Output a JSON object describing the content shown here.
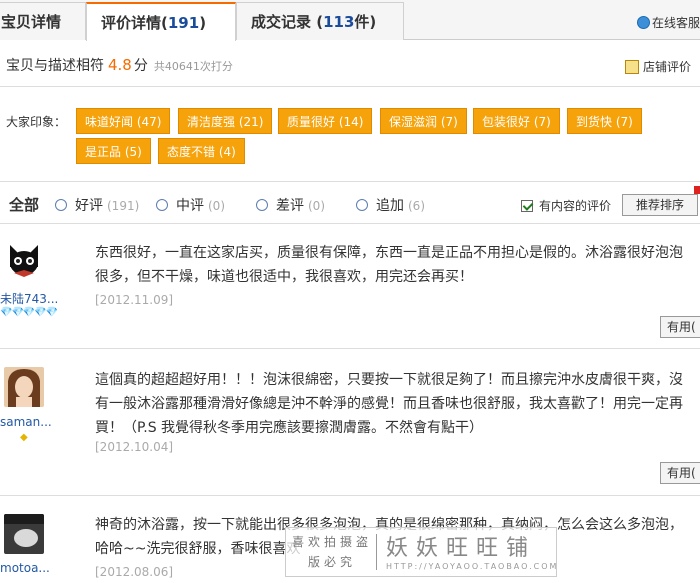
{
  "tabs": [
    {
      "label": "宝贝详情",
      "count": ""
    },
    {
      "label": "评价详情",
      "count": "191"
    },
    {
      "label": "成交记录",
      "count": "113",
      "suffix": "件"
    }
  ],
  "online_service": "在线客服",
  "score": {
    "label": "宝贝与描述相符",
    "value": "4.8",
    "unit": "分",
    "count_text": "共40641次打分",
    "shop_rating": "店铺评价"
  },
  "impressions": {
    "label": "大家印象：",
    "tags": [
      "味道好闻 (47)",
      "清洁度强 (21)",
      "质量很好 (14)",
      "保湿滋润 (7)",
      "包装很好 (7)",
      "到货快 (7)",
      "是正品 (5)",
      "态度不错 (4)"
    ]
  },
  "filter": {
    "all": "全部",
    "options": [
      {
        "label": "好评",
        "count": "(191)"
      },
      {
        "label": "中评",
        "count": "(0)"
      },
      {
        "label": "差评",
        "count": "(0)"
      },
      {
        "label": "追加",
        "count": "(6)"
      }
    ],
    "with_content": "有内容的评价",
    "sort": "推荐排序"
  },
  "reviews": [
    {
      "user": "未陆743...",
      "rank": "💎💎💎💎💎",
      "text": "东西很好，一直在这家店买，质量很有保障，东西一直是正品不用担心是假的。沐浴露很好泡泡很多，但不干燥，味道也很适中，我很喜欢，用完还会再买！",
      "date": "[2012.11.09]",
      "useful": "有用("
    },
    {
      "user": "saman...",
      "rank": "◆",
      "text": "這個真的超超超好用！！！泡沫很綿密，只要按一下就很足夠了！而且擦完沖水皮膚很干爽，沒有一般沐浴露那種滑滑好像總是沖不幹淨的感覺！而且香味也很舒服，我太喜歡了！用完一定再買！（P.S 我覺得秋冬季用完應該要擦潤膚露。不然會有點干）",
      "date": "[2012.10.04]",
      "useful": "有用("
    },
    {
      "user": "motoa...",
      "rank": "",
      "text": "神奇的沐浴露，按一下就能出很多很多泡泡，真的是很绵密那种，真纳闷，怎么会这么多泡泡，哈哈~~洗完很舒服，香味很喜欢",
      "date": "[2012.08.06]",
      "useful": ""
    }
  ],
  "watermark": {
    "left": "喜欢拍摄盗版必究",
    "right": "妖妖旺旺铺",
    "url": "HTTP://YAOYAOO.TAOBAO.COM"
  }
}
